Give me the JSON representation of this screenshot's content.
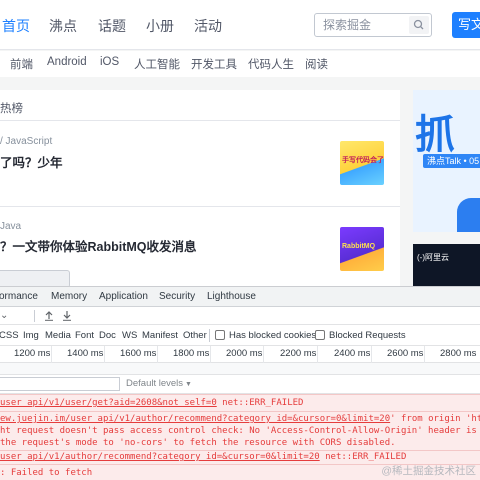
{
  "colors": {
    "accent": "#1e80ff",
    "error_text": "#e53c3c",
    "error_bg": "#fcebeb"
  },
  "topnav": {
    "links": [
      "首页",
      "沸点",
      "话题",
      "小册",
      "活动"
    ],
    "search_placeholder": "探索掘金",
    "write_button": "写文"
  },
  "categories": [
    "前端",
    "Android",
    "iOS",
    "人工智能",
    "开发工具",
    "代码人生",
    "阅读"
  ],
  "feed": {
    "header": "热榜",
    "articles": [
      {
        "tag": "/ JavaScript",
        "title": "了吗？少年",
        "thumb_text": "手写代码会了"
      },
      {
        "tag": "Java",
        "title": "？一文带你体验RabbitMQ收发消息",
        "thumb_text": "RabbitMQ"
      }
    ]
  },
  "banner": {
    "big_text": "抓",
    "talk": "沸点Talk • 05",
    "ad_logo": "(-)阿里云"
  },
  "devtools": {
    "tabs": [
      "ormance",
      "Memory",
      "Application",
      "Security",
      "Lighthouse"
    ],
    "filters": [
      "CSS",
      "Img",
      "Media",
      "Font",
      "Doc",
      "WS",
      "Manifest",
      "Other"
    ],
    "has_blocked_cookies": "Has blocked cookies",
    "blocked_requests": "Blocked Requests",
    "timeline_ticks": [
      "1200 ms",
      "1400 ms",
      "1600 ms",
      "1800 ms",
      "2000 ms",
      "2200 ms",
      "2400 ms",
      "2600 ms",
      "2800 ms"
    ],
    "default_levels": "Default levels",
    "console_lines": [
      {
        "link": "user_api/v1/user/get?aid=2608&not_self=0",
        "msg": " net::ERR_FAILED"
      },
      {
        "link": "ew.juejin.im/user_api/v1/author/recommend?category_id=&cursor=0&limit=20",
        "msg": "' from origin 'https:"
      },
      {
        "text": "ht request doesn't pass access control check: No 'Access-Control-Allow-Origin' header is pres"
      },
      {
        "text": " the request's mode to 'no-cors' to fetch the resource with CORS disabled."
      },
      {
        "link": "user_api/v1/author/recommend?category_id=&cursor=0&limit=20",
        "msg": " net::ERR_FAILED"
      },
      {
        "text": ": Failed to fetch"
      }
    ],
    "watermark": "@稀土掘金技术社区"
  }
}
